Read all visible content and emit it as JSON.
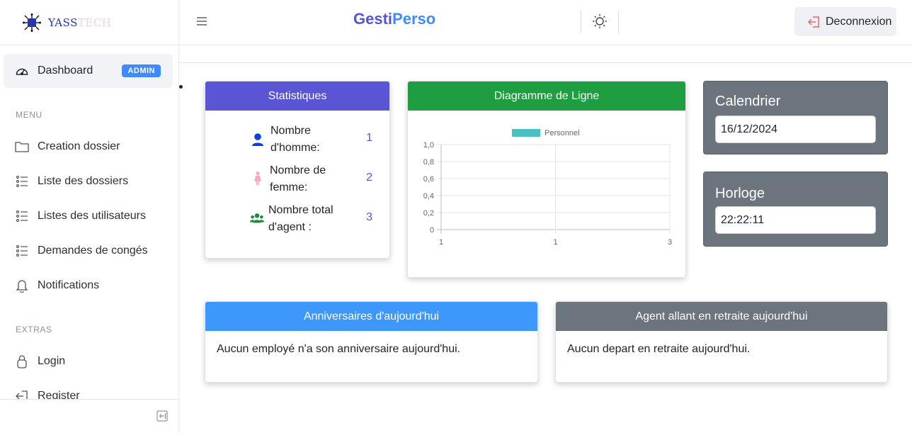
{
  "logo": {
    "text_a": "YASS",
    "text_b": "TECH"
  },
  "sidebar": {
    "dashboard_label": "Dashboard",
    "dashboard_badge": "ADMIN",
    "menu_title": "MENU",
    "items": [
      {
        "label": "Creation dossier",
        "icon": "folder-icon"
      },
      {
        "label": "Liste des dossiers",
        "icon": "list-icon"
      },
      {
        "label": "Listes des utilisateurs",
        "icon": "list-icon"
      },
      {
        "label": "Demandes de congés",
        "icon": "list-icon"
      },
      {
        "label": "Notifications",
        "icon": "bell-icon"
      }
    ],
    "extras_title": "EXTRAS",
    "extras": [
      {
        "label": "Login",
        "icon": "lock-icon"
      },
      {
        "label": "Register",
        "icon": "register-icon"
      }
    ]
  },
  "header": {
    "brand_a": "Gesti",
    "brand_b": "Perso",
    "logout_label": "Deconnexion"
  },
  "stats": {
    "title": "Statistiques",
    "rows": [
      {
        "label": "Nombre d'homme:",
        "value": "1",
        "icon": "male-icon"
      },
      {
        "label": "Nombre de femme:",
        "value": "2",
        "icon": "female-icon"
      },
      {
        "label": "Nombre total d'agent :",
        "value": "3",
        "icon": "users-icon"
      }
    ]
  },
  "line_chart_card": {
    "title": "Diagramme de Ligne"
  },
  "chart_data": {
    "type": "line",
    "x": [
      "1",
      "1",
      "3"
    ],
    "series": [
      {
        "name": "Personnel",
        "values": []
      }
    ],
    "ylim": [
      0,
      1.0
    ],
    "yticks": [
      "1,0",
      "0,8",
      "0,6",
      "0,4",
      "0,2",
      "0"
    ],
    "grid": true,
    "legend": "top",
    "color": "#4bc0c0"
  },
  "calendar": {
    "title": "Calendrier",
    "value": "16/12/2024"
  },
  "clock": {
    "title": "Horloge",
    "value": "22:22:11"
  },
  "birthdays": {
    "title": "Anniversaires d'aujourd'hui",
    "message": "Aucun employé n'a son anniversaire aujourd'hui."
  },
  "retirement": {
    "title": "Agent allant en retraite aujourd'hui",
    "message": "Aucun depart en retraite aujourd'hui."
  },
  "colors": {
    "stats_header": "#5955d4",
    "chart_header": "#1e9e40",
    "birthday_header": "#3e97fb",
    "retirement_header": "#6c757d",
    "accent": "#5655d4"
  }
}
